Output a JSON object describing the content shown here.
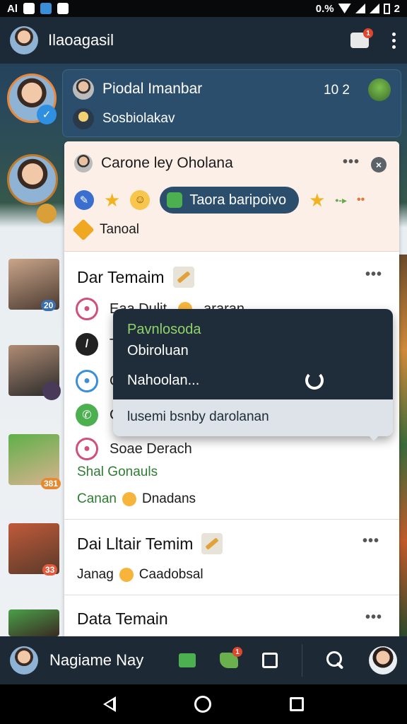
{
  "status_bar": {
    "left_text": "Al",
    "right_text": "0.%",
    "battery_text": "2"
  },
  "header": {
    "title": "Ilaoagasil",
    "notification_count": "1",
    "icons": [
      "avatar",
      "thumbs-up-icon",
      "more-vert-icon"
    ]
  },
  "notification": {
    "name": "Piodal Imanbar",
    "subtitle": "Sosbiolakav",
    "time": "10 2"
  },
  "sidebar_badges": [
    "20",
    "381",
    "33"
  ],
  "card": {
    "header_name": "Carone ley Oholana",
    "pill_label": "Taora baripoivo",
    "tag_label": "Tanoal"
  },
  "section_two": {
    "title": "Dar Temaim",
    "row1_text": "Eaa Dulit",
    "row1_text_b": "araran",
    "row2_text": "T",
    "row3_text": "C",
    "row4_text": "C",
    "row5_text": "Soae Derach",
    "green_line": "Shal Gonauls",
    "green_line_b": "Canan",
    "green_line_c": "Dnadans"
  },
  "popup": {
    "item_green": "Pavnlosoda",
    "item_1": "Obiroluan",
    "item_2": "Nahoolan...",
    "item_footer": "lusemi bsnby darolanan"
  },
  "section_three": {
    "title": "Dai Lltair Temim",
    "line_a": "Janag",
    "line_b": "Caadobsal"
  },
  "section_four": {
    "title": "Data Temain"
  },
  "bottom_bar": {
    "name": "Nagiame Nay",
    "badge": "1"
  },
  "colors": {
    "header_bg": "#1c2a38",
    "accent_blue": "#2c4e6d",
    "card_peach": "#fcefe8",
    "green_text": "#2e7d32",
    "popup_dark": "#1f2d3b",
    "popup_light": "#dde3e8"
  }
}
